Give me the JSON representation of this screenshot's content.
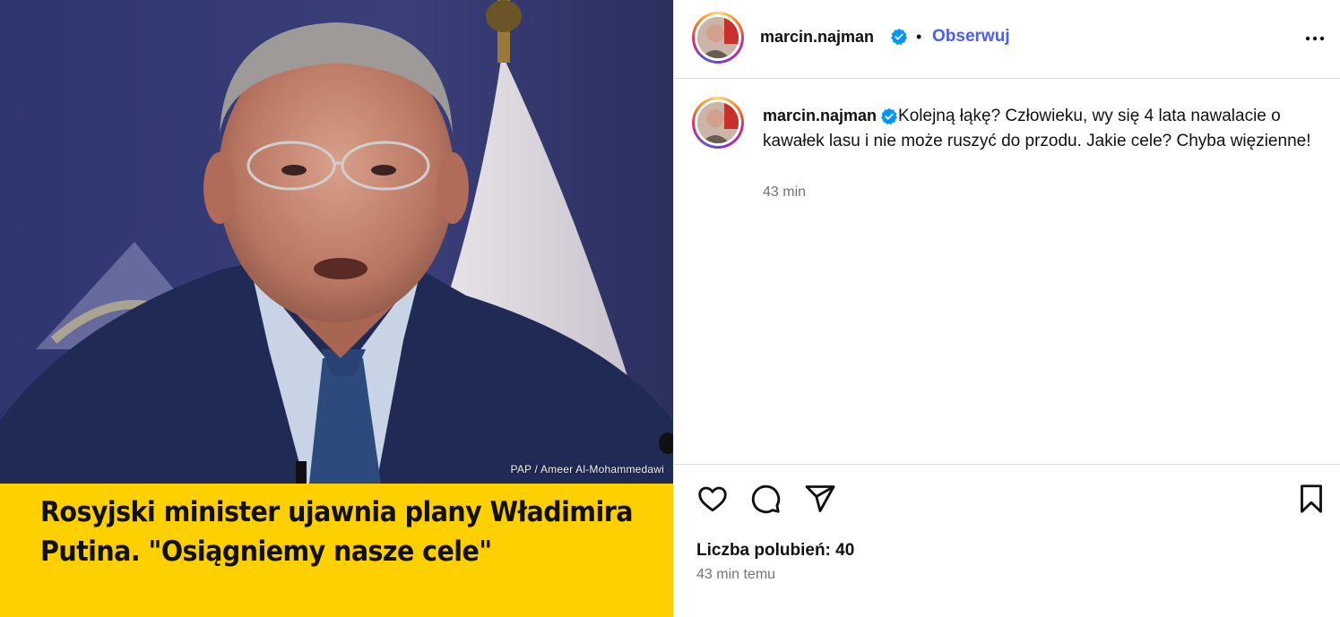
{
  "media": {
    "photo_credit": "PAP / Ameer Al-Mohammedawi",
    "headline": "Rosyjski minister ujawnia plany Władimira Putina. \"Osiągniemy nasze cele\""
  },
  "post": {
    "username": "marcin.najman",
    "separator": "•",
    "follow_label": "Obserwuj",
    "caption_username": "marcin.najman",
    "caption_text": "Kolejną łąkę? Człowieku, wy się 4 lata nawalacie o kawałek lasu i nie może ruszyć do przodu. Jakie cele? Chyba więzienne!",
    "caption_time": "43 min",
    "likes_label": "Liczba polubień: 40",
    "post_time": "43 min temu"
  },
  "icons": {
    "verified": "verified-badge-icon",
    "more": "more-options-icon",
    "like": "heart-icon",
    "comment": "comment-icon",
    "share": "share-icon",
    "save": "bookmark-icon"
  },
  "colors": {
    "accent_link": "#4a5df9",
    "verified_blue": "#0095f6",
    "headline_bg": "#ffd000",
    "secondary_text": "#737373"
  }
}
